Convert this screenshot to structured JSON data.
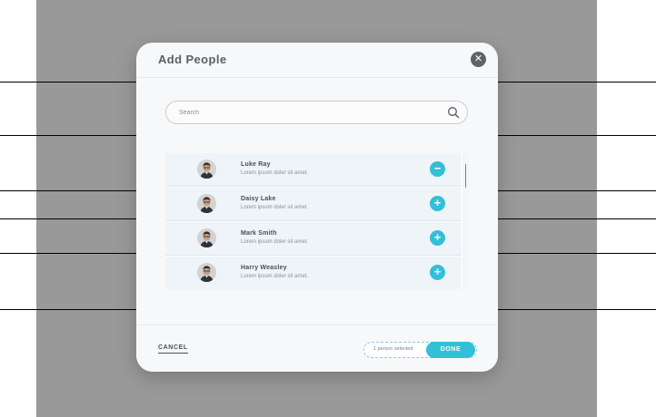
{
  "dialog": {
    "title": "Add People",
    "close_icon": "close-icon"
  },
  "search": {
    "placeholder": "Search",
    "icon": "search-icon"
  },
  "people": [
    {
      "name": "Luke Ray",
      "description": "Lorem ipsum doler sit amet.",
      "action": "remove",
      "action_symbol": "−"
    },
    {
      "name": "Daisy Lake",
      "description": "Lorem ipsum doler sit amet.",
      "action": "add",
      "action_symbol": "+"
    },
    {
      "name": "Mark Smith",
      "description": "Lorem ipsum doler sit amet.",
      "action": "add",
      "action_symbol": "+"
    },
    {
      "name": "Harry Weasley",
      "description": "Lorem ipsum doler sit amet.",
      "action": "add",
      "action_symbol": "+"
    }
  ],
  "footer": {
    "cancel_label": "CANCEL",
    "selection_text": "1 person selected",
    "done_label": "DONE"
  },
  "colors": {
    "accent": "#33bfd8",
    "backdrop": "#999999",
    "modal": "#f7f8f9"
  }
}
